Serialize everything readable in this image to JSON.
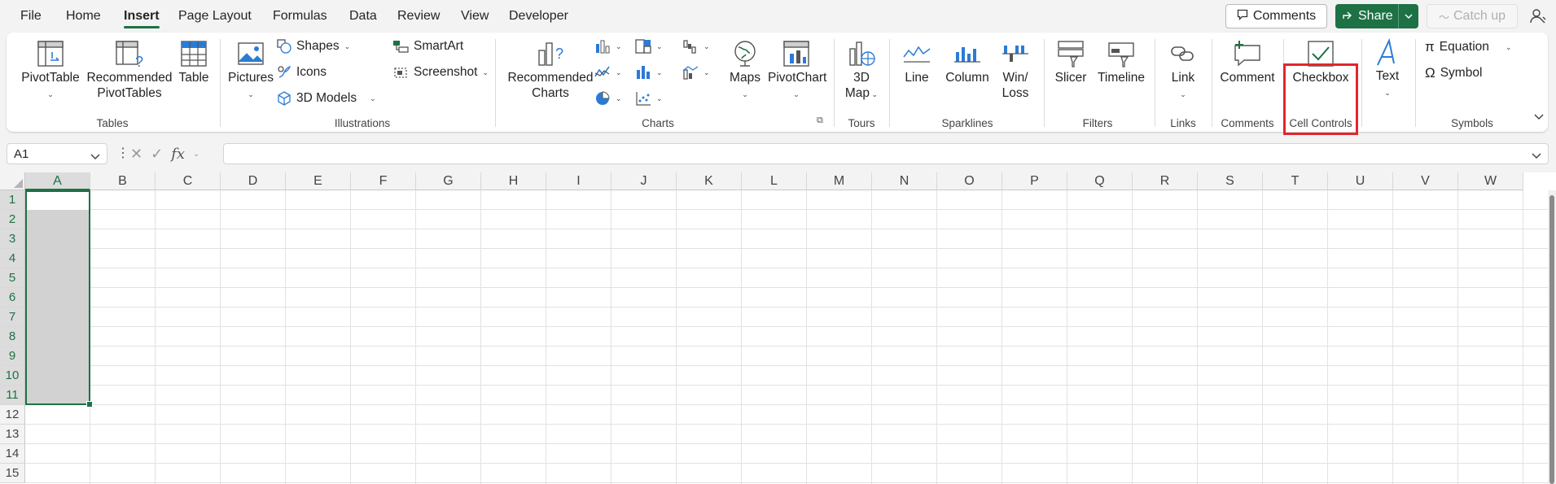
{
  "menu": {
    "tabs": [
      "File",
      "Home",
      "Insert",
      "Page Layout",
      "Formulas",
      "Data",
      "Review",
      "View",
      "Developer"
    ],
    "active_tab": "Insert",
    "comments_label": "Comments",
    "share_label": "Share",
    "catchup_label": "Catch up"
  },
  "ribbon": {
    "tables": {
      "group": "Tables",
      "pivottable": "PivotTable",
      "recommended_pivot_1": "Recommended",
      "recommended_pivot_2": "PivotTables",
      "table": "Table"
    },
    "illustrations": {
      "group": "Illustrations",
      "pictures": "Pictures",
      "shapes": "Shapes",
      "icons": "Icons",
      "models": "3D Models",
      "smartart": "SmartArt",
      "screenshot": "Screenshot"
    },
    "charts": {
      "group": "Charts",
      "recommended_1": "Recommended",
      "recommended_2": "Charts",
      "maps": "Maps",
      "pivotchart": "PivotChart"
    },
    "tours": {
      "group": "Tours",
      "map_1": "3D",
      "map_2": "Map"
    },
    "sparklines": {
      "group": "Sparklines",
      "line": "Line",
      "column": "Column",
      "winloss_1": "Win/",
      "winloss_2": "Loss"
    },
    "filters": {
      "group": "Filters",
      "slicer": "Slicer",
      "timeline": "Timeline"
    },
    "links": {
      "group": "Links",
      "link": "Link"
    },
    "comments": {
      "group": "Comments",
      "comment": "Comment"
    },
    "cell_controls": {
      "group": "Cell Controls",
      "checkbox": "Checkbox"
    },
    "text": {
      "text": "Text"
    },
    "symbols": {
      "group": "Symbols",
      "equation": "Equation",
      "symbol": "Symbol"
    }
  },
  "formula_bar": {
    "name_box": "A1",
    "fx": "fx",
    "formula": ""
  },
  "columns": [
    "A",
    "B",
    "C",
    "D",
    "E",
    "F",
    "G",
    "H",
    "I",
    "J",
    "K",
    "L",
    "M",
    "N",
    "O",
    "P",
    "Q",
    "R",
    "S",
    "T",
    "U",
    "V",
    "W"
  ],
  "rows": [
    "1",
    "2",
    "3",
    "4",
    "5",
    "6",
    "7",
    "8",
    "9",
    "10",
    "11",
    "12",
    "13",
    "14",
    "15"
  ],
  "selection": {
    "range": "A1:A11",
    "active_cell": "A1"
  },
  "colors": {
    "accent": "#1e7145",
    "highlight": "#e3262d"
  }
}
